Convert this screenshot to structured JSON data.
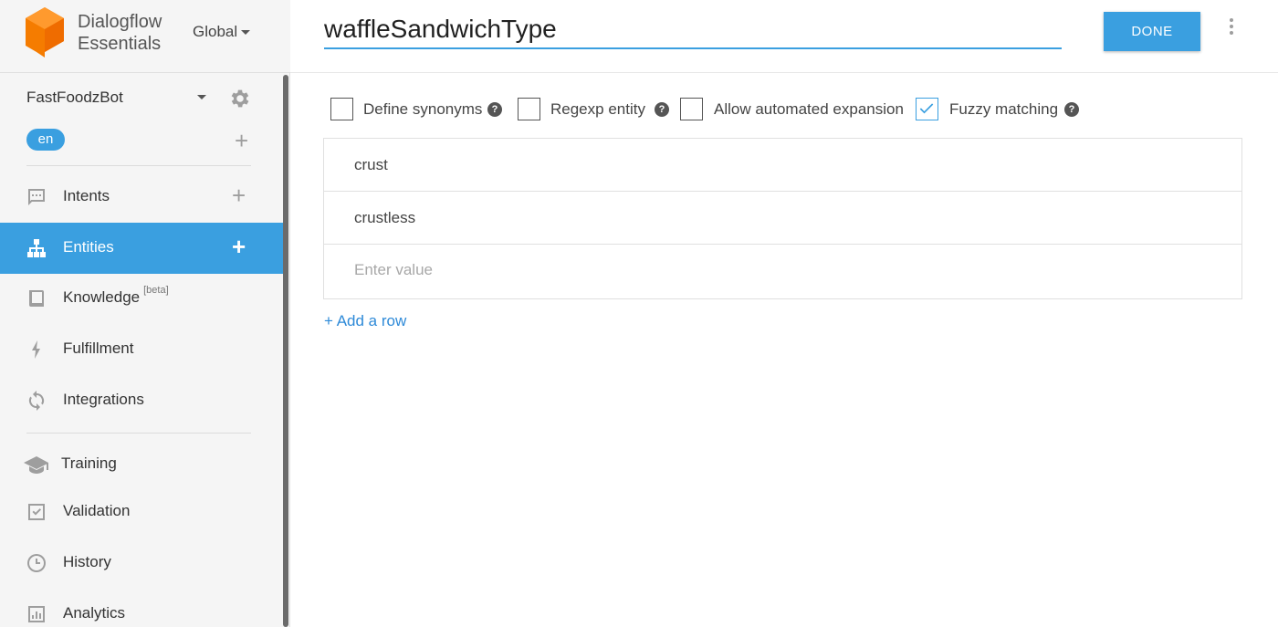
{
  "brand": {
    "line1": "Dialogflow",
    "line2": "Essentials",
    "region": "Global",
    "logo_color": "#f57c00"
  },
  "agent": {
    "name": "FastFoodzBot",
    "language": "en"
  },
  "nav": [
    {
      "label": "Intents",
      "icon": "chat-bubble-icon",
      "add": true,
      "active": false
    },
    {
      "label": "Entities",
      "icon": "hierarchy-icon",
      "add": true,
      "active": true
    },
    {
      "label": "Knowledge",
      "badge": "[beta]",
      "icon": "book-icon",
      "add": false,
      "active": false
    },
    {
      "label": "Fulfillment",
      "icon": "bolt-icon",
      "add": false,
      "active": false
    },
    {
      "label": "Integrations",
      "icon": "sync-icon",
      "add": false,
      "active": false
    },
    {
      "label": "Training",
      "icon": "graduation-cap-icon",
      "add": false,
      "active": false
    },
    {
      "label": "Validation",
      "icon": "checkbox-icon",
      "add": false,
      "active": false
    },
    {
      "label": "History",
      "icon": "clock-icon",
      "add": false,
      "active": false
    },
    {
      "label": "Analytics",
      "icon": "bar-chart-icon",
      "add": false,
      "active": false
    }
  ],
  "header": {
    "entity_name": "waffleSandwichType",
    "done_label": "DONE"
  },
  "options": [
    {
      "label": "Define synonyms",
      "checked": false,
      "help": true
    },
    {
      "label": "Regexp entity",
      "checked": false,
      "help": true
    },
    {
      "label": "Allow automated expansion",
      "checked": false,
      "help": false
    },
    {
      "label": "Fuzzy matching",
      "checked": true,
      "help": true
    }
  ],
  "entries": [
    "crust",
    "crustless"
  ],
  "new_entry_placeholder": "Enter value",
  "add_row_label": "+ Add a row",
  "colors": {
    "accent": "#3a9fe0",
    "sidebar_bg": "#f5f5f5"
  }
}
